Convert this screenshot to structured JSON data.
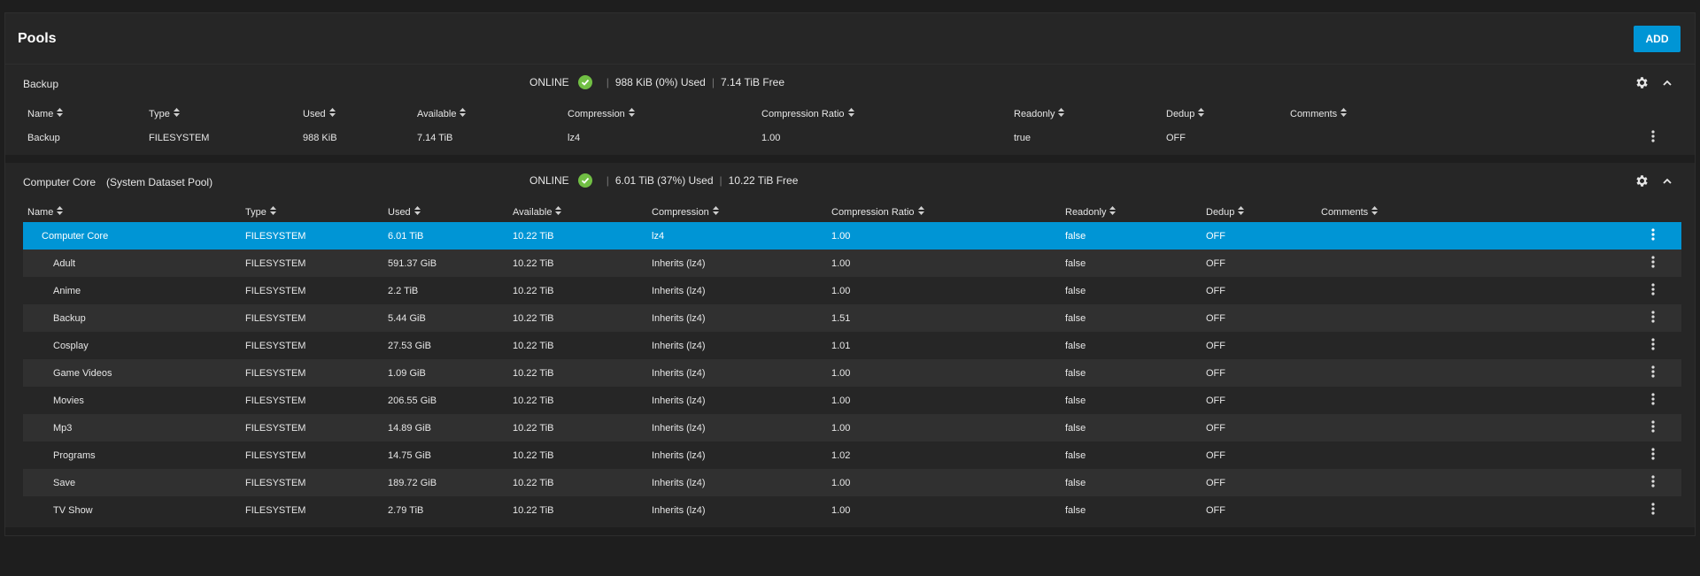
{
  "header": {
    "title": "Pools",
    "add_label": "ADD"
  },
  "colors": {
    "accent": "#0095d5",
    "online": "#71bf44"
  },
  "pools": [
    {
      "name": "Backup",
      "subtitle": "",
      "status": "ONLINE",
      "used": "988 KiB (0%) Used",
      "free": "7.14 TiB Free",
      "columns": [
        "Name",
        "Type",
        "Used",
        "Available",
        "Compression",
        "Compression Ratio",
        "Readonly",
        "Dedup",
        "Comments"
      ],
      "rows": [
        {
          "name": "Backup",
          "type": "FILESYSTEM",
          "used": "988 KiB",
          "available": "7.14 TiB",
          "compression": "lz4",
          "ratio": "1.00",
          "readonly": "true",
          "dedup": "OFF",
          "comments": ""
        }
      ]
    },
    {
      "name": "Computer Core",
      "subtitle": "(System Dataset Pool)",
      "status": "ONLINE",
      "used": "6.01 TiB (37%) Used",
      "free": "10.22 TiB Free",
      "columns": [
        "Name",
        "Type",
        "Used",
        "Available",
        "Compression",
        "Compression Ratio",
        "Readonly",
        "Dedup",
        "Comments"
      ],
      "rows": [
        {
          "name": "Computer Core",
          "type": "FILESYSTEM",
          "used": "6.01 TiB",
          "available": "10.22 TiB",
          "compression": "lz4",
          "ratio": "1.00",
          "readonly": "false",
          "dedup": "OFF",
          "comments": ""
        },
        {
          "name": "Adult",
          "type": "FILESYSTEM",
          "used": "591.37 GiB",
          "available": "10.22 TiB",
          "compression": "Inherits (lz4)",
          "ratio": "1.00",
          "readonly": "false",
          "dedup": "OFF",
          "comments": ""
        },
        {
          "name": "Anime",
          "type": "FILESYSTEM",
          "used": "2.2 TiB",
          "available": "10.22 TiB",
          "compression": "Inherits (lz4)",
          "ratio": "1.00",
          "readonly": "false",
          "dedup": "OFF",
          "comments": ""
        },
        {
          "name": "Backup",
          "type": "FILESYSTEM",
          "used": "5.44 GiB",
          "available": "10.22 TiB",
          "compression": "Inherits (lz4)",
          "ratio": "1.51",
          "readonly": "false",
          "dedup": "OFF",
          "comments": ""
        },
        {
          "name": "Cosplay",
          "type": "FILESYSTEM",
          "used": "27.53 GiB",
          "available": "10.22 TiB",
          "compression": "Inherits (lz4)",
          "ratio": "1.01",
          "readonly": "false",
          "dedup": "OFF",
          "comments": ""
        },
        {
          "name": "Game Videos",
          "type": "FILESYSTEM",
          "used": "1.09 GiB",
          "available": "10.22 TiB",
          "compression": "Inherits (lz4)",
          "ratio": "1.00",
          "readonly": "false",
          "dedup": "OFF",
          "comments": ""
        },
        {
          "name": "Movies",
          "type": "FILESYSTEM",
          "used": "206.55 GiB",
          "available": "10.22 TiB",
          "compression": "Inherits (lz4)",
          "ratio": "1.00",
          "readonly": "false",
          "dedup": "OFF",
          "comments": ""
        },
        {
          "name": "Mp3",
          "type": "FILESYSTEM",
          "used": "14.89 GiB",
          "available": "10.22 TiB",
          "compression": "Inherits (lz4)",
          "ratio": "1.00",
          "readonly": "false",
          "dedup": "OFF",
          "comments": ""
        },
        {
          "name": "Programs",
          "type": "FILESYSTEM",
          "used": "14.75 GiB",
          "available": "10.22 TiB",
          "compression": "Inherits (lz4)",
          "ratio": "1.02",
          "readonly": "false",
          "dedup": "OFF",
          "comments": ""
        },
        {
          "name": "Save",
          "type": "FILESYSTEM",
          "used": "189.72 GiB",
          "available": "10.22 TiB",
          "compression": "Inherits (lz4)",
          "ratio": "1.00",
          "readonly": "false",
          "dedup": "OFF",
          "comments": ""
        },
        {
          "name": "TV Show",
          "type": "FILESYSTEM",
          "used": "2.79 TiB",
          "available": "10.22 TiB",
          "compression": "Inherits (lz4)",
          "ratio": "1.00",
          "readonly": "false",
          "dedup": "OFF",
          "comments": ""
        }
      ]
    }
  ]
}
